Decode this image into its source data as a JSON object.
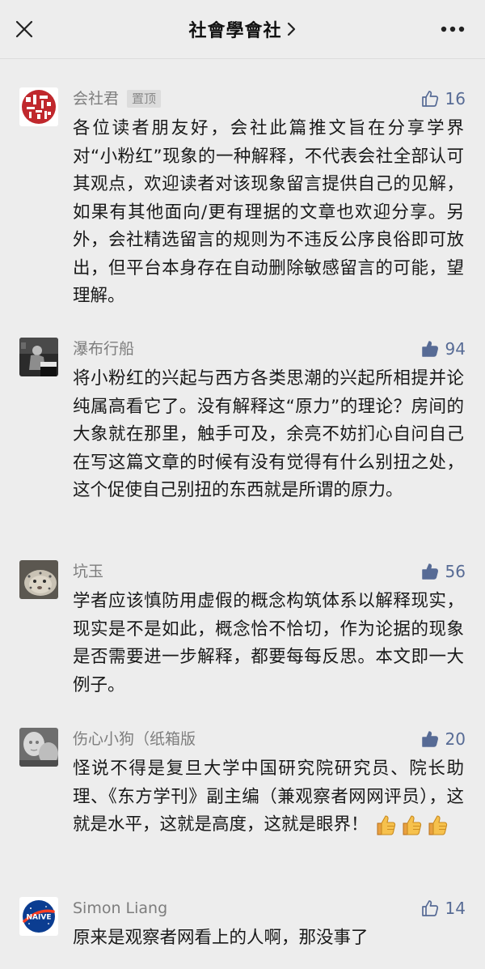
{
  "header": {
    "title": "社會學會社",
    "title_chevron": "›",
    "close_icon": "close-icon",
    "more_icon": "more-dots-icon"
  },
  "colors": {
    "background": "#ededed",
    "name_gray": "#7d7d7d",
    "like_blue": "#576b95",
    "text": "#191919"
  },
  "comments": [
    {
      "name": "会社君",
      "tag": "置顶",
      "likes": "16",
      "liked": false,
      "avatar": "seal-logo-avatar",
      "text": "各位读者朋友好，会社此篇推文旨在分享学界对“小粉红”现象的一种解释，不代表会社全部认可其观点，欢迎读者对该现象留言提供自己的见解，如果有其他面向/更有理据的文章也欢迎分享。另外，会社精选留言的规则为不违反公序良俗即可放出，但平台本身存在自动删除敏感留言的可能，望理解。"
    },
    {
      "name": "瀑布行船",
      "likes": "94",
      "liked": true,
      "avatar": "pianist-photo-avatar",
      "text": "将小粉红的兴起与西方各类思潮的兴起所相提并论纯属高看它了。没有解释这“原力”的理论？房间的大象就在那里，触手可及，余亮不妨扪心自问自己在写这篇文章的时候有没有觉得有什么别扭之处，这个促使自己别扭的东西就是所谓的原力。"
    },
    {
      "name": "坑玉",
      "likes": "56",
      "liked": true,
      "avatar": "snow-leopard-avatar",
      "text": "学者应该慎防用虚假的概念构筑体系以解释现实，现实是不是如此，概念恰不恰切，作为论据的现象是否需要进一步解释，都要每每反思。本文即一大例子。"
    },
    {
      "name": "伤心小狗（纸箱版",
      "likes": "20",
      "liked": true,
      "avatar": "statue-photo-avatar",
      "text": "怪说不得是复旦大学中国研究院研究员、院长助理、《东方学刊》副主编（兼观察者网网评员），这就是水平，这就是高度，这就是眼界！",
      "emoji": [
        "👍",
        "👍",
        "👍"
      ]
    },
    {
      "name": "Simon Liang",
      "likes": "14",
      "liked": false,
      "avatar": "nasa-logo-avatar",
      "text": "原来是观察者网看上的人啊，那没事了"
    }
  ]
}
